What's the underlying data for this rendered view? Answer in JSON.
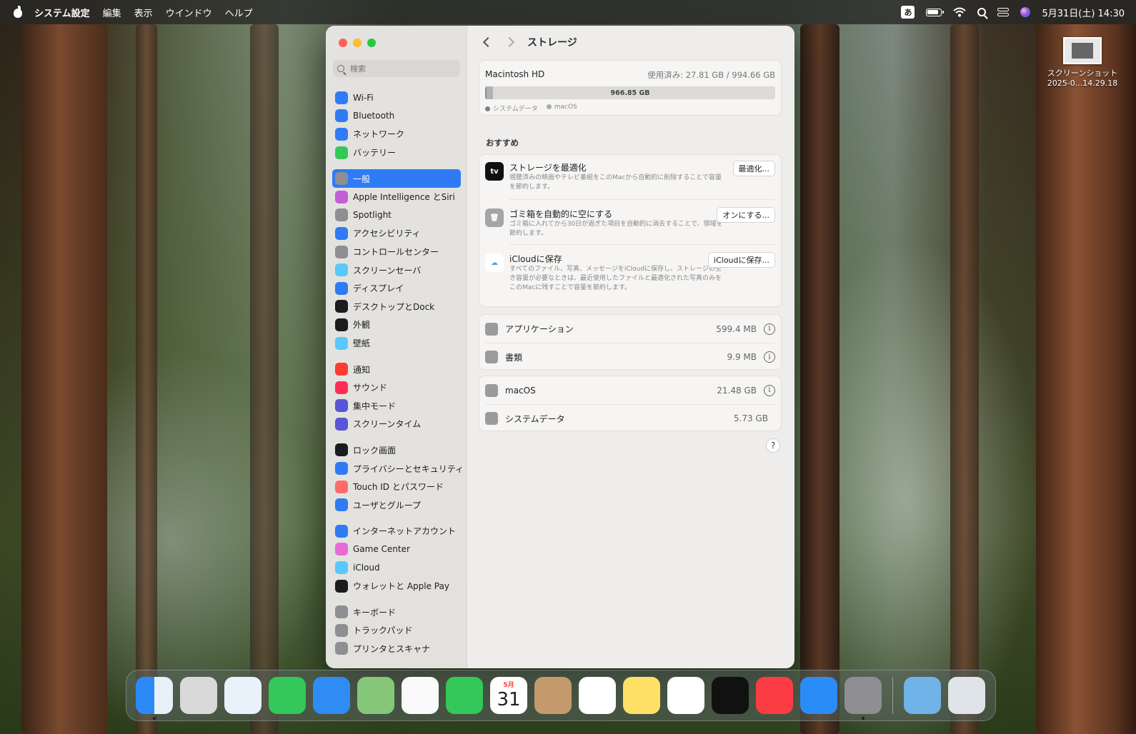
{
  "menubar": {
    "items": [
      "システム設定",
      "編集",
      "表示",
      "ウインドウ",
      "ヘルプ"
    ],
    "ime": "あ",
    "clock": "5月31日(土) 14:30"
  },
  "desktop_file": {
    "line1": "スクリーンショット",
    "line2": "2025-0...14.29.18"
  },
  "sidebar": {
    "search_placeholder": "検索",
    "groups": [
      [
        {
          "label": "Wi-Fi",
          "icon": "wifi-icon",
          "color": "#2f7bf5"
        },
        {
          "label": "Bluetooth",
          "icon": "bluetooth-icon",
          "color": "#2f7bf5"
        },
        {
          "label": "ネットワーク",
          "icon": "globe-icon",
          "color": "#2f7bf5"
        },
        {
          "label": "バッテリー",
          "icon": "battery-icon",
          "color": "#34c759"
        }
      ],
      [
        {
          "label": "一般",
          "icon": "gear-icon",
          "color": "#8e8e93",
          "selected": true
        },
        {
          "label": "Apple Intelligence とSiri",
          "icon": "siri-icon",
          "color": "#c05fd6"
        },
        {
          "label": "Spotlight",
          "icon": "spotlight-icon",
          "color": "#8e8e93"
        },
        {
          "label": "アクセシビリティ",
          "icon": "accessibility-icon",
          "color": "#2f7bf5"
        },
        {
          "label": "コントロールセンター",
          "icon": "control-center-icon",
          "color": "#8e8e93"
        },
        {
          "label": "スクリーンセーバ",
          "icon": "screensaver-icon",
          "color": "#5ac8fa"
        },
        {
          "label": "ディスプレイ",
          "icon": "display-icon",
          "color": "#2f7bf5"
        },
        {
          "label": "デスクトップとDock",
          "icon": "dock-icon",
          "color": "#1c1c1e"
        },
        {
          "label": "外観",
          "icon": "appearance-icon",
          "color": "#1c1c1e"
        },
        {
          "label": "壁紙",
          "icon": "wallpaper-icon",
          "color": "#5ac8fa"
        }
      ],
      [
        {
          "label": "通知",
          "icon": "notification-icon",
          "color": "#ff3b30"
        },
        {
          "label": "サウンド",
          "icon": "sound-icon",
          "color": "#ff2d55"
        },
        {
          "label": "集中モード",
          "icon": "focus-icon",
          "color": "#5856d6"
        },
        {
          "label": "スクリーンタイム",
          "icon": "screentime-icon",
          "color": "#5856d6"
        }
      ],
      [
        {
          "label": "ロック画面",
          "icon": "lock-icon",
          "color": "#1c1c1e"
        },
        {
          "label": "プライバシーとセキュリティ",
          "icon": "hand-icon",
          "color": "#2f7bf5"
        },
        {
          "label": "Touch ID とパスワード",
          "icon": "fingerprint-icon",
          "color": "#ff6b6b"
        },
        {
          "label": "ユーザとグループ",
          "icon": "users-icon",
          "color": "#2f7bf5"
        }
      ],
      [
        {
          "label": "インターネットアカウント",
          "icon": "at-icon",
          "color": "#2f7bf5"
        },
        {
          "label": "Game Center",
          "icon": "gamecenter-icon",
          "color": "#e86ad6"
        },
        {
          "label": "iCloud",
          "icon": "cloud-icon",
          "color": "#5ac8fa"
        },
        {
          "label": "ウォレットと Apple Pay",
          "icon": "wallet-icon",
          "color": "#1c1c1e"
        }
      ],
      [
        {
          "label": "キーボード",
          "icon": "keyboard-icon",
          "color": "#8e8e93"
        },
        {
          "label": "トラックパッド",
          "icon": "trackpad-icon",
          "color": "#8e8e93"
        },
        {
          "label": "プリンタとスキャナ",
          "icon": "printer-icon",
          "color": "#8e8e93"
        }
      ]
    ]
  },
  "main": {
    "title": "ストレージ",
    "disk": {
      "name": "Macintosh HD",
      "used": "使用済み: 27.81 GB / 994.66 GB",
      "free": "966.85 GB",
      "used_fraction_system": 0.006,
      "used_fraction_macos": 0.022,
      "legend": [
        "システムデータ",
        "macOS"
      ]
    },
    "recommend_heading": "おすすめ",
    "recommendations": [
      {
        "title": "ストレージを最適化",
        "desc": "視聴済みの映画やテレビ番組をこのMacから自動的に削除することで容量を節約します。",
        "button": "最適化...",
        "icon": "appletv-icon",
        "icon_text": "tv"
      },
      {
        "title": "ゴミ箱を自動的に空にする",
        "desc": "ゴミ箱に入れてから30日が過ぎた項目を自動的に消去することで、領域を節約します。",
        "button": "オンにする...",
        "icon": "trash-icon",
        "icon_text": "🗑"
      },
      {
        "title": "iCloudに保存",
        "desc": "すべてのファイル、写真、メッセージをiCloudに保存し、ストレージの空き容量が必要なときは、最近使用したファイルと最適化された写真のみをこのMacに残すことで容量を節約します。",
        "button": "iCloudに保存...",
        "icon": "icloud-icon",
        "icon_text": "☁"
      }
    ],
    "categories1": [
      {
        "label": "アプリケーション",
        "size": "599.4 MB",
        "icon": "app-store-icon",
        "info": true
      },
      {
        "label": "書類",
        "size": "9.9 MB",
        "icon": "document-icon",
        "info": true
      }
    ],
    "categories2": [
      {
        "label": "macOS",
        "size": "21.48 GB",
        "icon": "laptop-icon",
        "info": true
      },
      {
        "label": "システムデータ",
        "size": "5.73 GB",
        "icon": "ellipsis-icon",
        "info": false
      }
    ],
    "help": "?"
  },
  "dock": {
    "calendar_month": "5月",
    "calendar_day": "31",
    "apps": [
      {
        "name": "finder",
        "color": "linear-gradient(90deg,#2b8af7 50%,#e8f0fa 50%)",
        "running": true
      },
      {
        "name": "launchpad",
        "color": "#d9d9d9"
      },
      {
        "name": "safari",
        "color": "#e9f1fb"
      },
      {
        "name": "messages",
        "color": "#34c759"
      },
      {
        "name": "mail",
        "color": "#2f8cf5"
      },
      {
        "name": "maps",
        "color": "#86c77a"
      },
      {
        "name": "photos",
        "color": "#fafafa"
      },
      {
        "name": "facetime",
        "color": "#34c759"
      },
      {
        "name": "calendar",
        "color": "#ffffff"
      },
      {
        "name": "contacts",
        "color": "#c49a6c"
      },
      {
        "name": "reminders",
        "color": "#ffffff"
      },
      {
        "name": "notes",
        "color": "#ffe066"
      },
      {
        "name": "freeform",
        "color": "#ffffff"
      },
      {
        "name": "tv",
        "color": "#111111"
      },
      {
        "name": "music",
        "color": "#fc3c44"
      },
      {
        "name": "app-store",
        "color": "#2a8cf7"
      },
      {
        "name": "system-settings",
        "color": "#8e8e93",
        "running": true
      }
    ],
    "trailing": [
      {
        "name": "downloads",
        "color": "#6fb3e8"
      },
      {
        "name": "trash",
        "color": "#dfe4e8"
      }
    ]
  }
}
